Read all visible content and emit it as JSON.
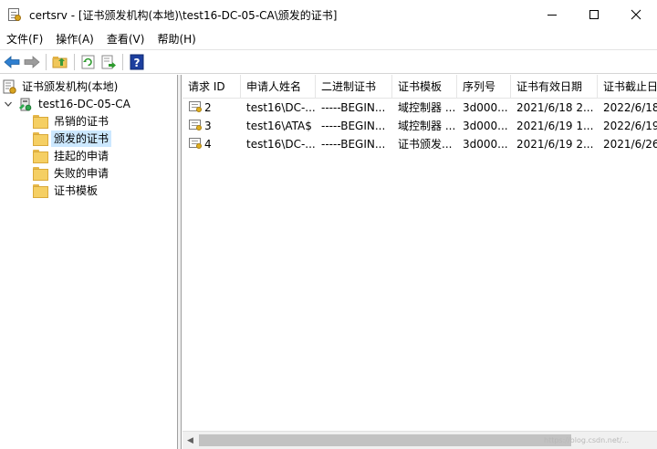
{
  "window": {
    "title": "certsrv - [证书颁发机构(本地)\\test16-DC-05-CA\\颁发的证书]",
    "minimize_glyph": "—",
    "maximize_glyph": "☐",
    "close_glyph": "✕"
  },
  "menu": [
    "文件(F)",
    "操作(A)",
    "查看(V)",
    "帮助(H)"
  ],
  "toolbar": {
    "icons": [
      "back-arrow-icon",
      "forward-arrow-icon",
      "up-folder-icon",
      "refresh-icon",
      "export-list-icon",
      "help-icon"
    ],
    "help_glyph": "?"
  },
  "tree": {
    "root": "证书颁发机构(本地)",
    "ca": "test16-DC-05-CA",
    "expand_glyph": "⌄",
    "children": [
      "吊销的证书",
      "颁发的证书",
      "挂起的申请",
      "失败的申请",
      "证书模板"
    ],
    "selected_index": 1
  },
  "table": {
    "columns": [
      "请求 ID",
      "申请人姓名",
      "二进制证书",
      "证书模板",
      "序列号",
      "证书有效日期",
      "证书截止日"
    ],
    "rows": [
      [
        "2",
        "test16\\DC-...",
        "-----BEGIN...",
        "域控制器 ...",
        "3d000...",
        "2021/6/18 2...",
        "2022/6/18"
      ],
      [
        "3",
        "test16\\ATA$",
        "-----BEGIN...",
        "域控制器 ...",
        "3d000...",
        "2021/6/19 1...",
        "2022/6/19"
      ],
      [
        "4",
        "test16\\DC-...",
        "-----BEGIN...",
        "证书颁发...",
        "3d000...",
        "2021/6/19 2...",
        "2021/6/26"
      ]
    ]
  },
  "scrollbar": {
    "left_arrow": "◀"
  },
  "watermark": "https://blog.csdn.net/..."
}
